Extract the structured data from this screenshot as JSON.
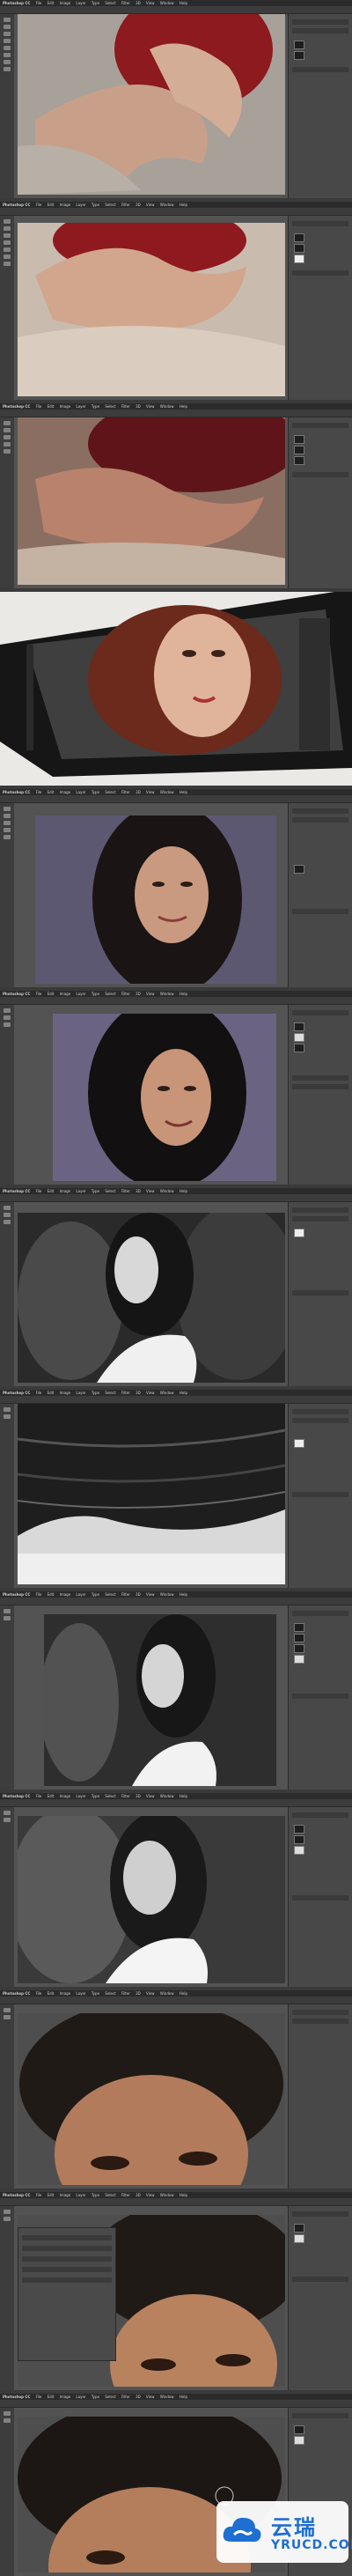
{
  "menu": {
    "app": "Photoshop CC",
    "items": [
      "File",
      "Edit",
      "Image",
      "Layer",
      "Type",
      "Select",
      "Filter",
      "3D",
      "View",
      "Window",
      "Help"
    ]
  },
  "watermark": {
    "chinese": "云瑞",
    "domain": "YRUCD.COM"
  }
}
